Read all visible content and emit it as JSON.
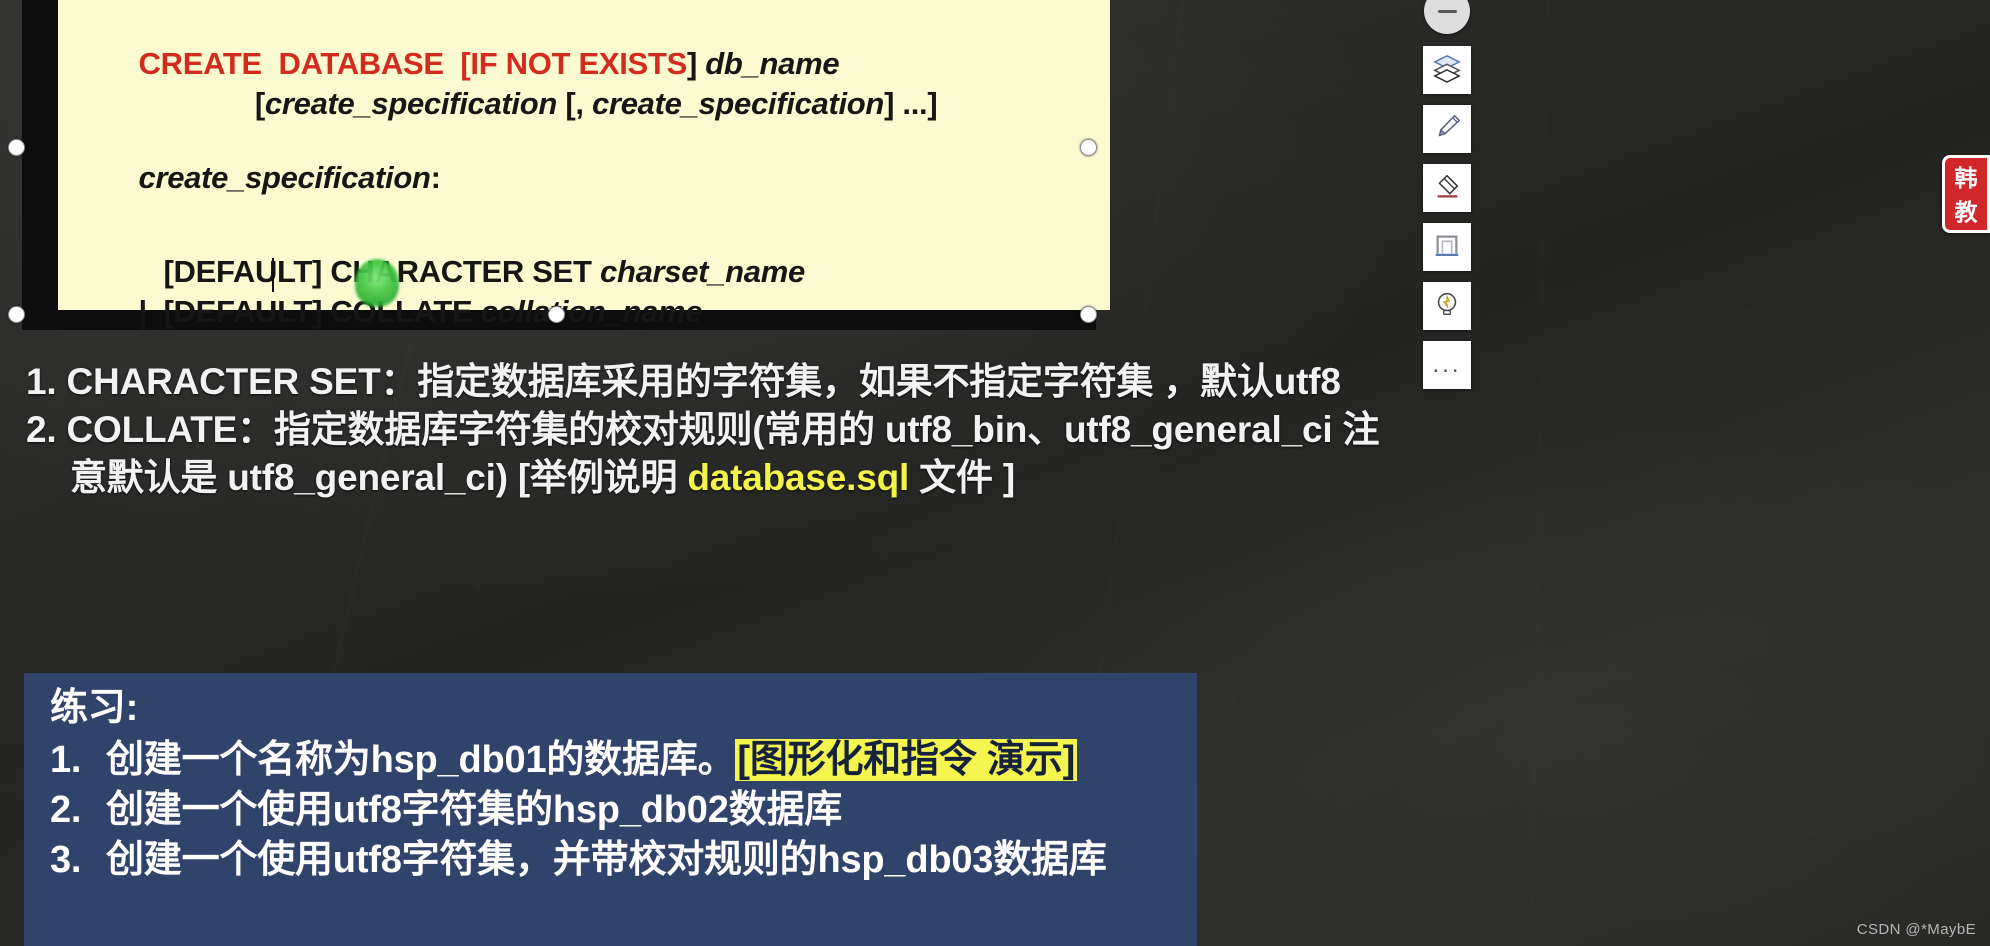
{
  "app": {
    "kind": "presentation-slide-screen-recording",
    "background_color": "#2b2b29",
    "watermark": "CSDN @*MaybE"
  },
  "code_block": {
    "background_color": "#fbfad0",
    "frame_color": "#0d0d0d",
    "keyword_color": "#d42b1f",
    "selected": true,
    "lines": [
      {
        "id": "l1",
        "parts": [
          {
            "text": "CREATE  DATABASE  [",
            "style": "keyword"
          },
          {
            "text": "IF NOT EXISTS",
            "style": "keyword"
          },
          {
            "text": "] ",
            "style": "plain"
          },
          {
            "text": "db_name",
            "style": "italic"
          }
        ]
      },
      {
        "id": "l2",
        "parts": [
          {
            "text": "              [",
            "style": "plain"
          },
          {
            "text": "create_specification",
            "style": "italic"
          },
          {
            "text": " [, ",
            "style": "plain"
          },
          {
            "text": "create_specification",
            "style": "italic"
          },
          {
            "text": "] ...]",
            "style": "plain"
          }
        ]
      },
      {
        "id": "l3",
        "parts": [
          {
            "text": "create_specification",
            "style": "italic"
          },
          {
            "text": ":",
            "style": "plain"
          }
        ]
      },
      {
        "id": "l4",
        "parts": [
          {
            "text": "   [DEFAULT] CHARACTER SET ",
            "style": "plain"
          },
          {
            "text": "charset_name",
            "style": "italic"
          }
        ]
      },
      {
        "id": "l5",
        "parts": [
          {
            "text": "|  [DEFAULT] COLLATE ",
            "style": "plain"
          },
          {
            "text": "collation_name",
            "style": "italic"
          }
        ]
      }
    ]
  },
  "notes": {
    "items": [
      {
        "index": "1.",
        "term": "CHARACTER SET",
        "text": "1. CHARACTER SET：指定数据库采用的字符集，如果不指定字符集 ，默认utf8"
      },
      {
        "index": "2.",
        "term": "COLLATE",
        "line1": "2. COLLATE：指定数据库字符集的校对规则(常用的 utf8_bin、utf8_general_ci 注",
        "line2_prefix": "意默认是 utf8_general_ci) [举例说明 ",
        "line2_highlight": "database.sql",
        "line2_suffix": " 文件 ]",
        "highlight_color": "#f3f34a"
      }
    ]
  },
  "practice": {
    "background_color": "#30436a",
    "title": "练习:",
    "items": [
      {
        "num": "1.",
        "prefix": "创建一个名称为hsp_db01的数据库。",
        "marked": "[图形化和指令 演示]",
        "suffix": "",
        "mark_color": "#f5f54f"
      },
      {
        "num": "2.",
        "prefix": "创建一个使用utf8字符集的hsp_db02数据库",
        "marked": "",
        "suffix": ""
      },
      {
        "num": "3.",
        "prefix": "创建一个使用utf8字符集，并带校对规则的hsp_db03数据库",
        "marked": "",
        "suffix": ""
      }
    ]
  },
  "toolbar": {
    "collapse_label": "collapse",
    "buttons": [
      {
        "name": "layers",
        "label": "图层"
      },
      {
        "name": "brush",
        "label": "画笔"
      },
      {
        "name": "eraser",
        "label": "橡皮"
      },
      {
        "name": "frame",
        "label": "白板"
      },
      {
        "name": "idea",
        "label": "灵感"
      },
      {
        "name": "more",
        "label": "..."
      }
    ]
  },
  "seal": {
    "line1": "韩",
    "line2": "教",
    "color": "#d0272a"
  }
}
